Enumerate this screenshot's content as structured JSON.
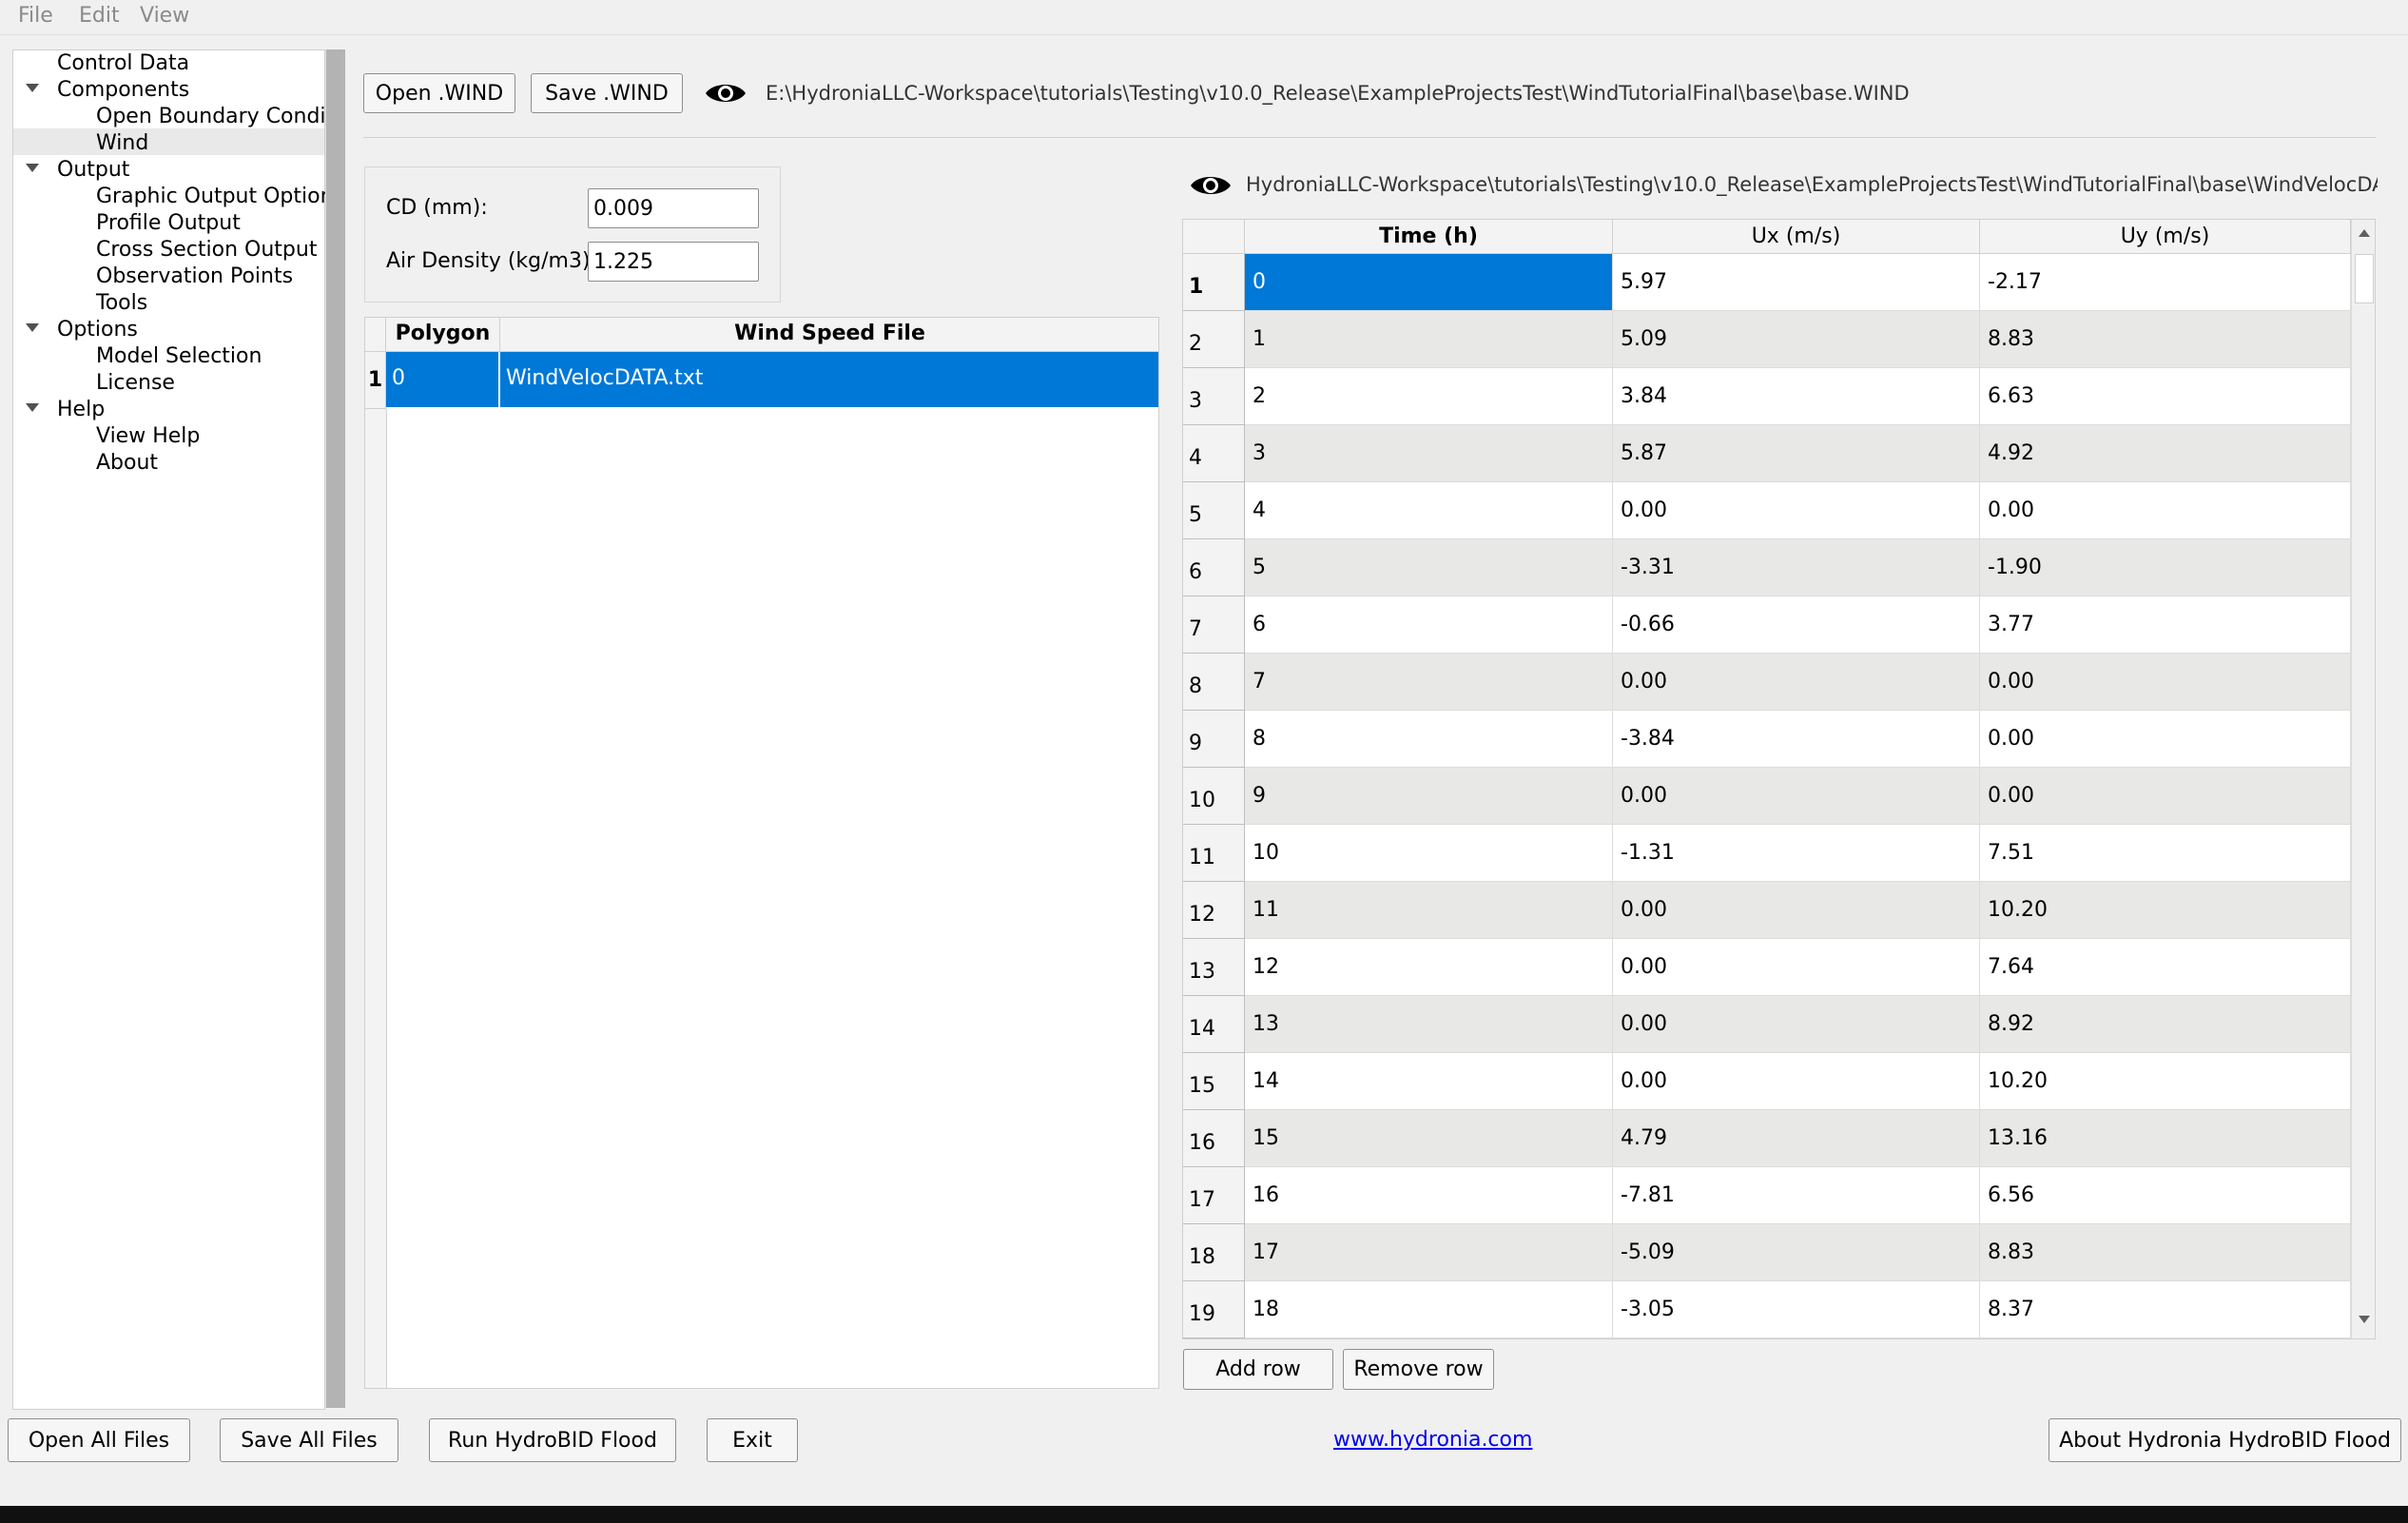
{
  "menu": {
    "file": "File",
    "edit": "Edit",
    "view": "View"
  },
  "tree": {
    "control_data": "Control Data",
    "components": "Components",
    "open_boundary": "Open Boundary Condi...",
    "wind": "Wind",
    "output": "Output",
    "graphic_output": "Graphic Output Options",
    "profile_output": "Profile Output",
    "cross_section_output": "Cross Section Output",
    "observation_points": "Observation Points",
    "tools": "Tools",
    "options": "Options",
    "model_selection": "Model Selection",
    "license": "License",
    "help": "Help",
    "view_help": "View Help",
    "about": "About"
  },
  "toolbar": {
    "open_wind": "Open .WIND",
    "save_wind": "Save .WIND",
    "wind_file_path": "E:\\HydroniaLLC-Workspace\\tutorials\\Testing\\v10.0_Release\\ExampleProjectsTest\\WindTutorialFinal\\base\\base.WIND"
  },
  "params": {
    "cd_label": "CD (mm):",
    "cd_value": "0.009",
    "air_density_label": "Air Density (kg/m3):",
    "air_density_value": "1.225"
  },
  "polygon_table": {
    "col_polygon": "Polygon",
    "col_file": "Wind Speed File",
    "row_number": "1",
    "polygon": "0",
    "file": "WindVelocDATA.txt"
  },
  "data_path": "HydroniaLLC-Workspace\\tutorials\\Testing\\v10.0_Release\\ExampleProjectsTest\\WindTutorialFinal\\base\\WindVelocDATA.txt",
  "data_table": {
    "headers": [
      "Time (h)",
      "Ux (m/s)",
      "Uy (m/s)"
    ],
    "rows": [
      [
        "1",
        "0",
        "5.97",
        "-2.17"
      ],
      [
        "2",
        "1",
        "5.09",
        "8.83"
      ],
      [
        "3",
        "2",
        "3.84",
        "6.63"
      ],
      [
        "4",
        "3",
        "5.87",
        "4.92"
      ],
      [
        "5",
        "4",
        "0.00",
        "0.00"
      ],
      [
        "6",
        "5",
        "-3.31",
        "-1.90"
      ],
      [
        "7",
        "6",
        "-0.66",
        "3.77"
      ],
      [
        "8",
        "7",
        "0.00",
        "0.00"
      ],
      [
        "9",
        "8",
        "-3.84",
        "0.00"
      ],
      [
        "10",
        "9",
        "0.00",
        "0.00"
      ],
      [
        "11",
        "10",
        "-1.31",
        "7.51"
      ],
      [
        "12",
        "11",
        "0.00",
        "10.20"
      ],
      [
        "13",
        "12",
        "0.00",
        "7.64"
      ],
      [
        "14",
        "13",
        "0.00",
        "8.92"
      ],
      [
        "15",
        "14",
        "0.00",
        "10.20"
      ],
      [
        "16",
        "15",
        "4.79",
        "13.16"
      ],
      [
        "17",
        "16",
        "-7.81",
        "6.56"
      ],
      [
        "18",
        "17",
        "-5.09",
        "8.83"
      ],
      [
        "19",
        "18",
        "-3.05",
        "8.37"
      ]
    ],
    "add_row": "Add row",
    "remove_row": "Remove row"
  },
  "footer": {
    "open_all": "Open All Files",
    "save_all": "Save All Files",
    "run": "Run HydroBID Flood",
    "exit": "Exit",
    "website": "www.hydronia.com",
    "about": "About Hydronia HydroBID Flood"
  },
  "colors": {
    "selection": "#0078d7",
    "alt_row": "#e8e8e6"
  },
  "icons": {
    "view_wind_file": "eye-icon",
    "view_data_file": "eye-icon"
  }
}
